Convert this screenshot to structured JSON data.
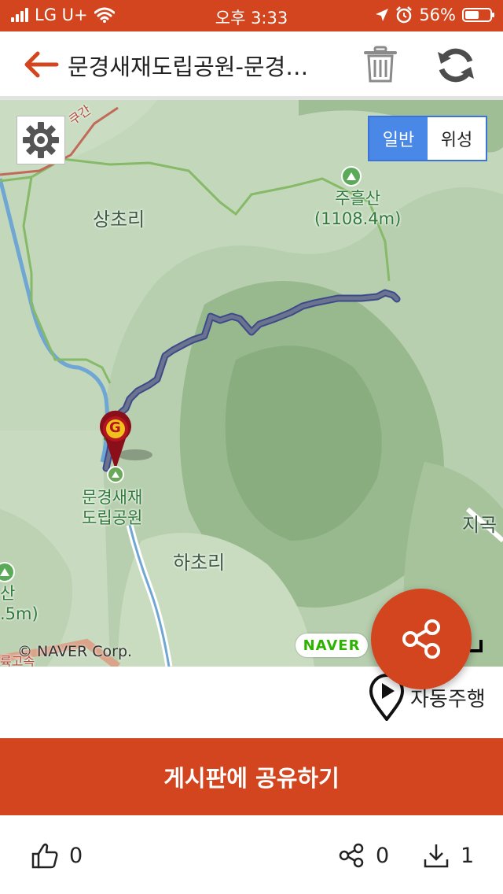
{
  "status_bar": {
    "carrier": "LG U+",
    "time": "오후 3:33",
    "battery_text": "56%",
    "battery_level": 0.56
  },
  "header": {
    "title": "문경새재도립공원-문경…"
  },
  "map": {
    "map_type_options": [
      "일반",
      "위성"
    ],
    "selected_map_type": "일반",
    "labels": {
      "sangcho": "상초리",
      "hacho": "하초리",
      "jugok": "지곡",
      "peak_name": "주흘산",
      "peak_elev": "(1108.4m)",
      "park_line1": "문경새재",
      "park_line2": "도립공원",
      "left_peak_name": "산",
      "left_peak_elev": ".5m)",
      "road_top": "쿠간",
      "road_bottom": "륙고속"
    },
    "marker_letter": "G",
    "copyright": "© NAVER Corp.",
    "logo": "NAVER"
  },
  "actions": {
    "autoplay_label": "자동주행",
    "share_board_label": "게시판에 공유하기"
  },
  "stats": {
    "likes": "0",
    "shares": "0",
    "downloads": "1"
  },
  "colors": {
    "accent": "#d2451e",
    "map_type_active": "#4a88e8",
    "track": "#5e6b8a",
    "naver_green": "#2db400"
  }
}
